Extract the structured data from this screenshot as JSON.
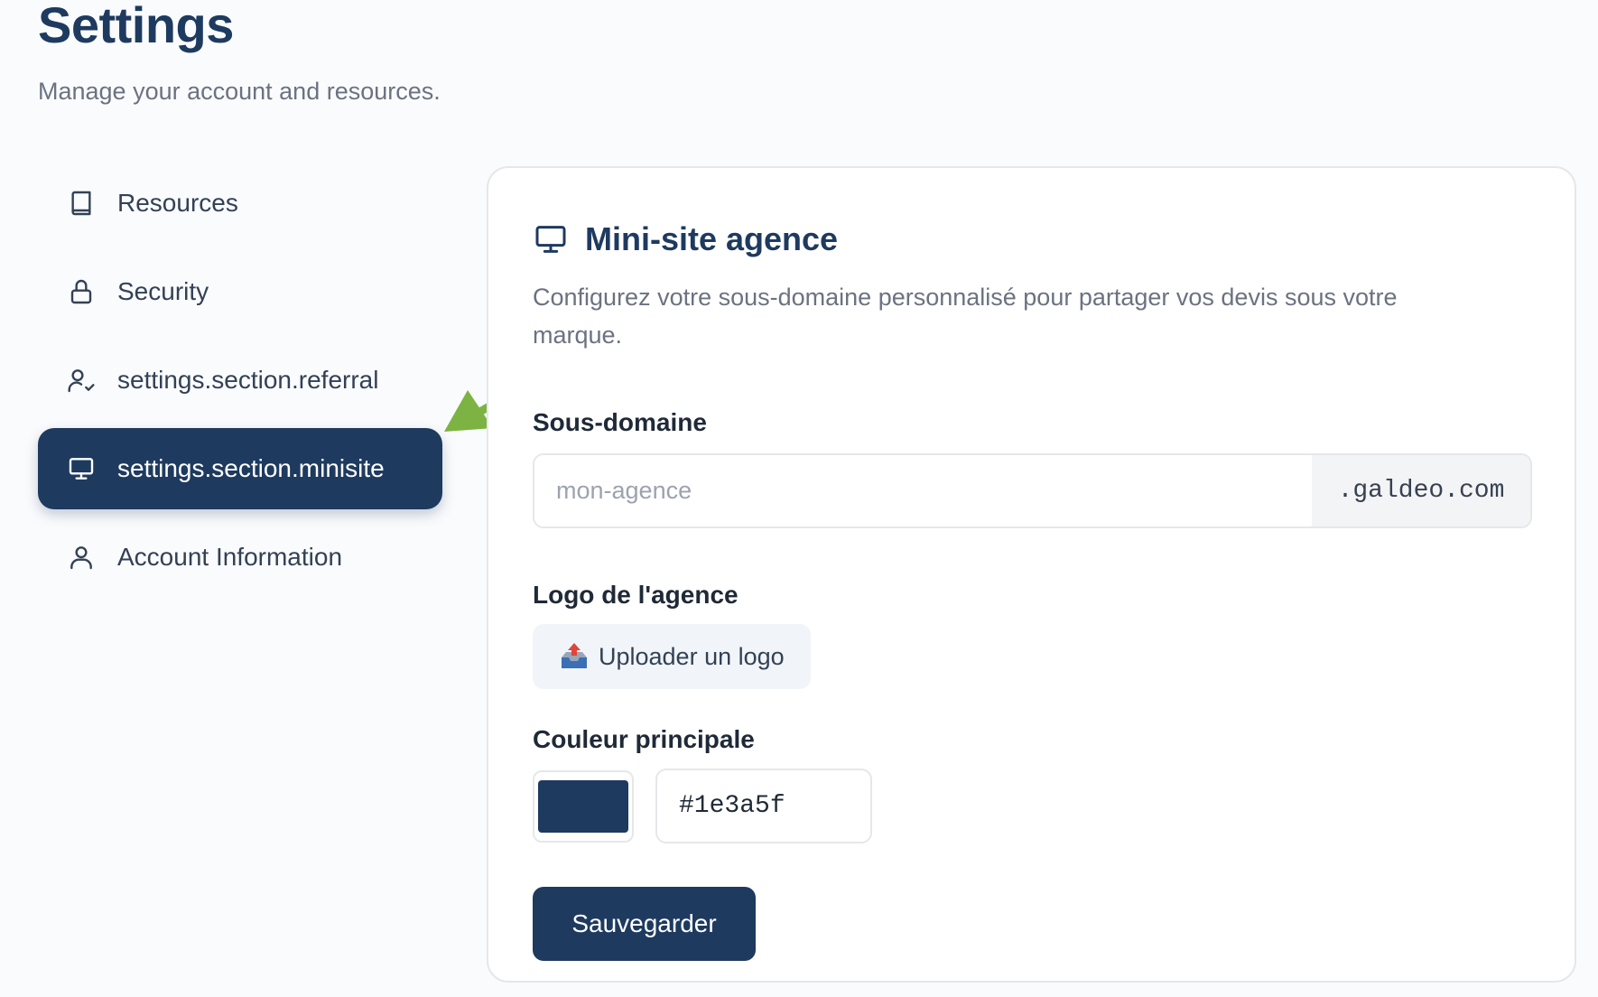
{
  "header": {
    "title": "Settings",
    "subtitle": "Manage your account and resources."
  },
  "sidebar": {
    "items": [
      {
        "label": "Resources",
        "icon": "book-icon"
      },
      {
        "label": "Security",
        "icon": "lock-icon"
      },
      {
        "label": "settings.section.referral",
        "icon": "user-check-icon"
      },
      {
        "label": "settings.section.minisite",
        "icon": "monitor-icon",
        "active": true
      },
      {
        "label": "Account Information",
        "icon": "user-icon"
      }
    ]
  },
  "card": {
    "icon": "monitor-icon",
    "title": "Mini-site agence",
    "description": "Configurez votre sous-domaine personnalisé pour partager vos devis sous votre marque.",
    "subdomain": {
      "label": "Sous-domaine",
      "placeholder": "mon-agence",
      "value": "",
      "suffix": ".galdeo.com"
    },
    "logo": {
      "label": "Logo de l'agence",
      "button_label": "Uploader un logo",
      "button_icon": "outbox-tray-icon"
    },
    "color": {
      "label": "Couleur principale",
      "value": "#1e3a5f"
    },
    "save_label": "Sauvegarder"
  },
  "colors": {
    "accent": "#1e3a5f",
    "annotation_arrow": "#7cb342"
  }
}
